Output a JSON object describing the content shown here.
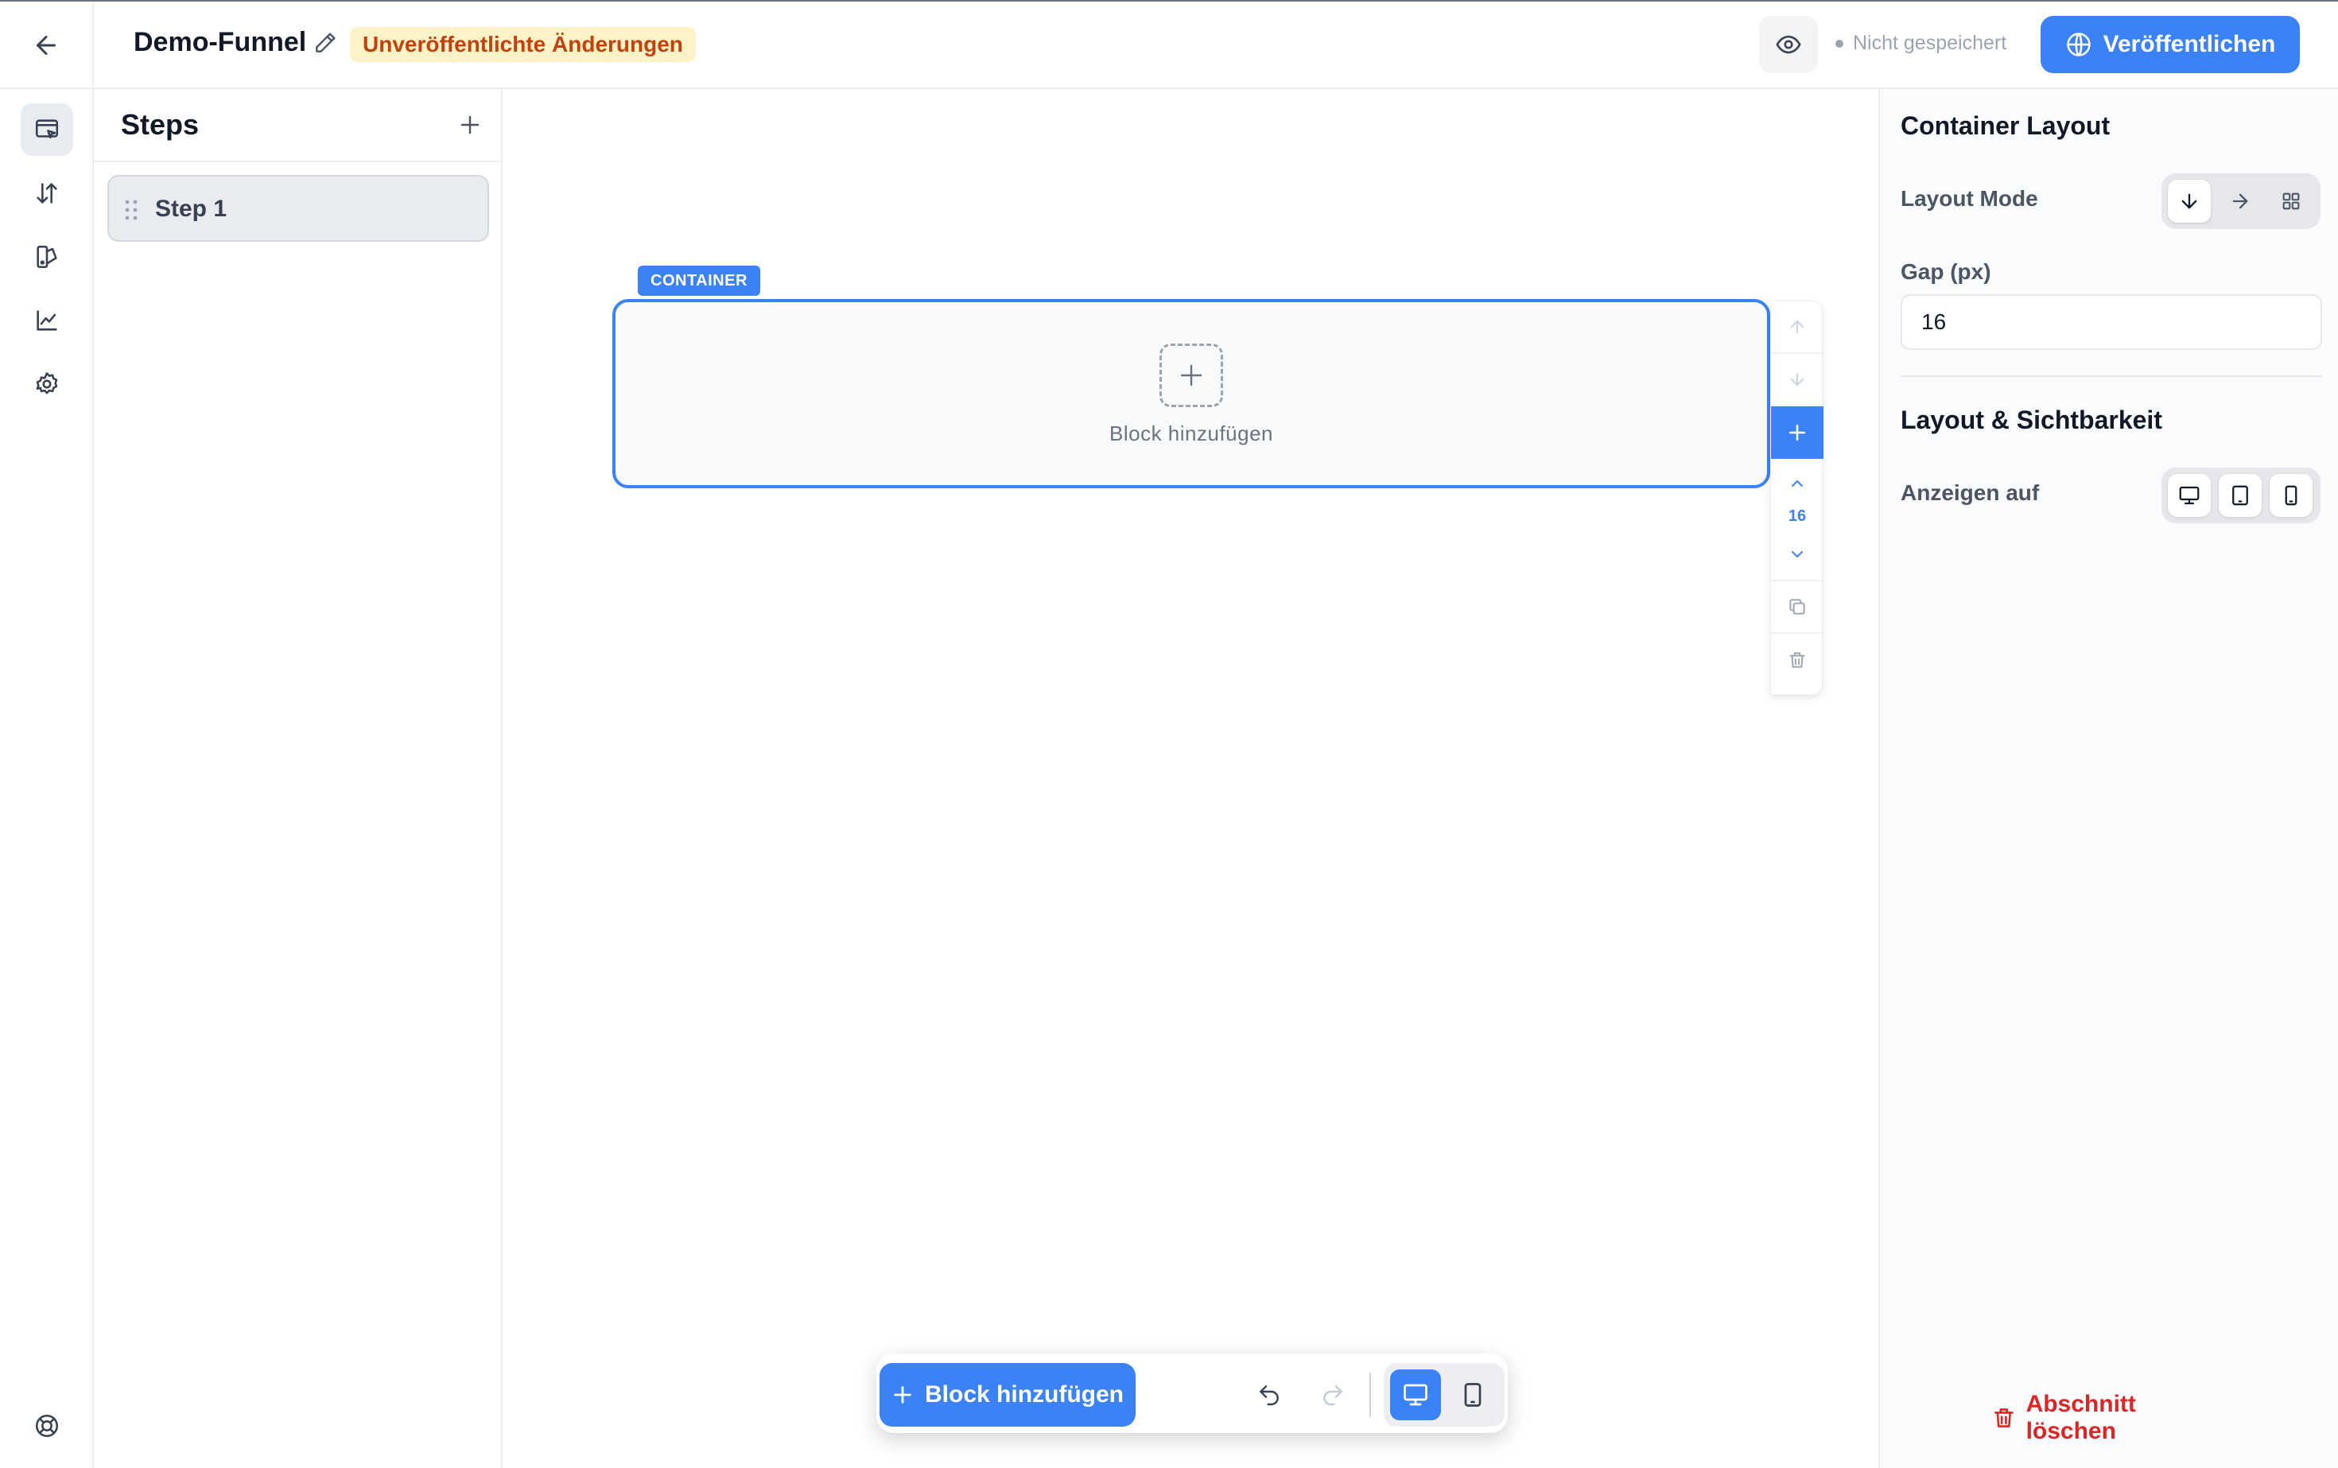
{
  "header": {
    "funnel_name": "Demo-Funnel",
    "unpublished_badge": "Unveröffentlichte Änderungen",
    "save_status": "Nicht gespeichert",
    "publish_label": "Veröffentlichen"
  },
  "rail": {
    "items": [
      {
        "icon": "editor-icon",
        "active": true
      },
      {
        "icon": "sort-arrows-icon",
        "active": false
      },
      {
        "icon": "design-palette-icon",
        "active": false
      },
      {
        "icon": "analytics-chart-icon",
        "active": false
      },
      {
        "icon": "settings-gear-icon",
        "active": false
      }
    ],
    "bottom_icon": "help-lifebuoy-icon"
  },
  "steps": {
    "title": "Steps",
    "items": [
      {
        "label": "Step 1",
        "selected": true
      }
    ]
  },
  "canvas": {
    "container_tag": "CONTAINER",
    "placeholder_label": "Block hinzufügen",
    "gap_value": "16"
  },
  "bottom_toolbar": {
    "add_block_label": "Block hinzufügen",
    "device_active": "desktop"
  },
  "properties": {
    "container_layout_title": "Container Layout",
    "layout_mode_label": "Layout Mode",
    "layout_mode_options": [
      "vertical",
      "horizontal",
      "grid"
    ],
    "layout_mode_selected": "vertical",
    "gap_label": "Gap (px)",
    "gap_value": "16",
    "visibility_title": "Layout & Sichtbarkeit",
    "show_on_label": "Anzeigen auf",
    "show_on_devices": [
      "desktop",
      "tablet",
      "mobile"
    ],
    "delete_label": "Abschnitt löschen"
  },
  "colors": {
    "accent": "#3b82f6",
    "warning_bg": "#fef3c7",
    "warning_text": "#c2410c",
    "danger": "#dc2626"
  }
}
